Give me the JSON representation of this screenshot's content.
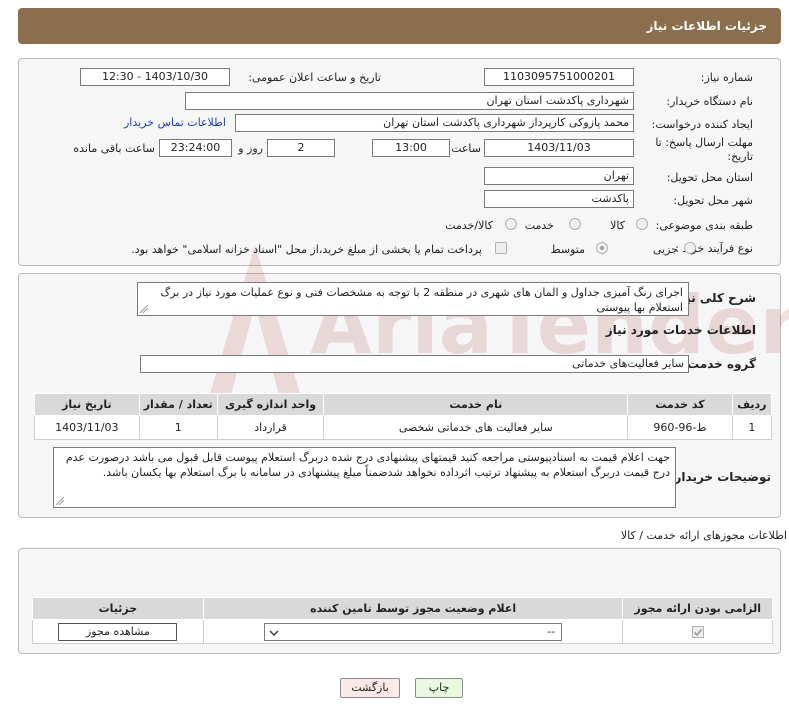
{
  "header": {
    "title": "جزئیات اطلاعات نیاز"
  },
  "form": {
    "need_number_label": "شماره نیاز:",
    "need_number": "1103095751000201",
    "announce_label": "تاریخ و ساعت اعلان عمومی:",
    "announce_value": "1403/10/30 - 12:30",
    "buyer_org_label": "نام دستگاه خریدار:",
    "buyer_org": "شهرداری پاکدشت استان تهران",
    "requester_label": "ایجاد کننده درخواست:",
    "requester": "محمد پازوکی کارپرداز شهرداری پاکدشت استان تهران",
    "buyer_contact_link": "اطلاعات تماس خریدار",
    "deadline_label": "مهلت ارسال پاسخ: تا تاریخ:",
    "deadline_date": "1403/11/03",
    "time_label": "ساعت",
    "deadline_time": "13:00",
    "days_value": "2",
    "days_label": "روز و",
    "remaining_time": "23:24:00",
    "remaining_label": "ساعت باقی مانده",
    "province_label": "استان محل تحویل:",
    "province": "تهران",
    "city_label": "شهر محل تحویل:",
    "city": "پاکدشت",
    "category_label": "طبقه بندی موضوعی:",
    "category_options": [
      "کالا",
      "خدمت",
      "کالا/خدمت"
    ],
    "process_label": "نوع فرآیند خرید :",
    "process_options": [
      "جزیی",
      "متوسط"
    ],
    "payment_note": "پرداخت تمام یا بخشی از مبلغ خرید،از محل \"اسناد خزانه اسلامی\" خواهد بود."
  },
  "summary": {
    "label": "شرح کلی نیاز:",
    "text": "اجرای رنگ آمیزی جداول و المان های شهری در منطقه 2  با توجه به مشخصات فنی و نوع عملیات مورد نیاز در برگ استعلام بها پیوستی",
    "services_title": "اطلاعات خدمات مورد نیاز",
    "group_label": "گروه خدمت:",
    "group_value": "سایر فعالیت‌های خدماتی"
  },
  "services_table": {
    "headers": [
      "ردیف",
      "کد خدمت",
      "نام خدمت",
      "واحد اندازه گیری",
      "تعداد / مقدار",
      "تاریخ نیاز"
    ],
    "rows": [
      [
        "1",
        "ط-96-960",
        "سایر فعالیت های خدماتی شخصی",
        "قرارداد",
        "1",
        "1403/11/03"
      ]
    ]
  },
  "buyer_notes": {
    "label": "توضیحات خریدار:",
    "text": "جهت اعلام قیمت به اسنادپیوستی مراجعه کنید قیمتهای پیشنهادی درج شده دربرگ استعلام پیوست قابل قبول می باشد درصورت عدم درج قیمت دربرگ استعلام به پیشنهاد ترتیب اثرداده نخواهد شدضمناً مبلغ پیشنهادی در سامانه با برگ استعلام بها یکسان باشد."
  },
  "permits": {
    "title": "اطلاعات مجوزهای ارائه خدمت / کالا",
    "headers": [
      "الزامی بودن ارائه مجوز",
      "اعلام وضعیت مجوز توسط تامین کننده",
      "جزئیات"
    ],
    "select_value": "--",
    "view_button": "مشاهده مجوز"
  },
  "footer": {
    "print_button": "چاپ",
    "back_button": "بازگشت"
  },
  "watermark": {
    "text": "AriaTender.neT"
  },
  "colors": {
    "header_bg": "#8b6e4e",
    "link": "#1a3fb5",
    "back_button_bg": "#fde8e8",
    "print_button_bg": "#e9f9df"
  }
}
